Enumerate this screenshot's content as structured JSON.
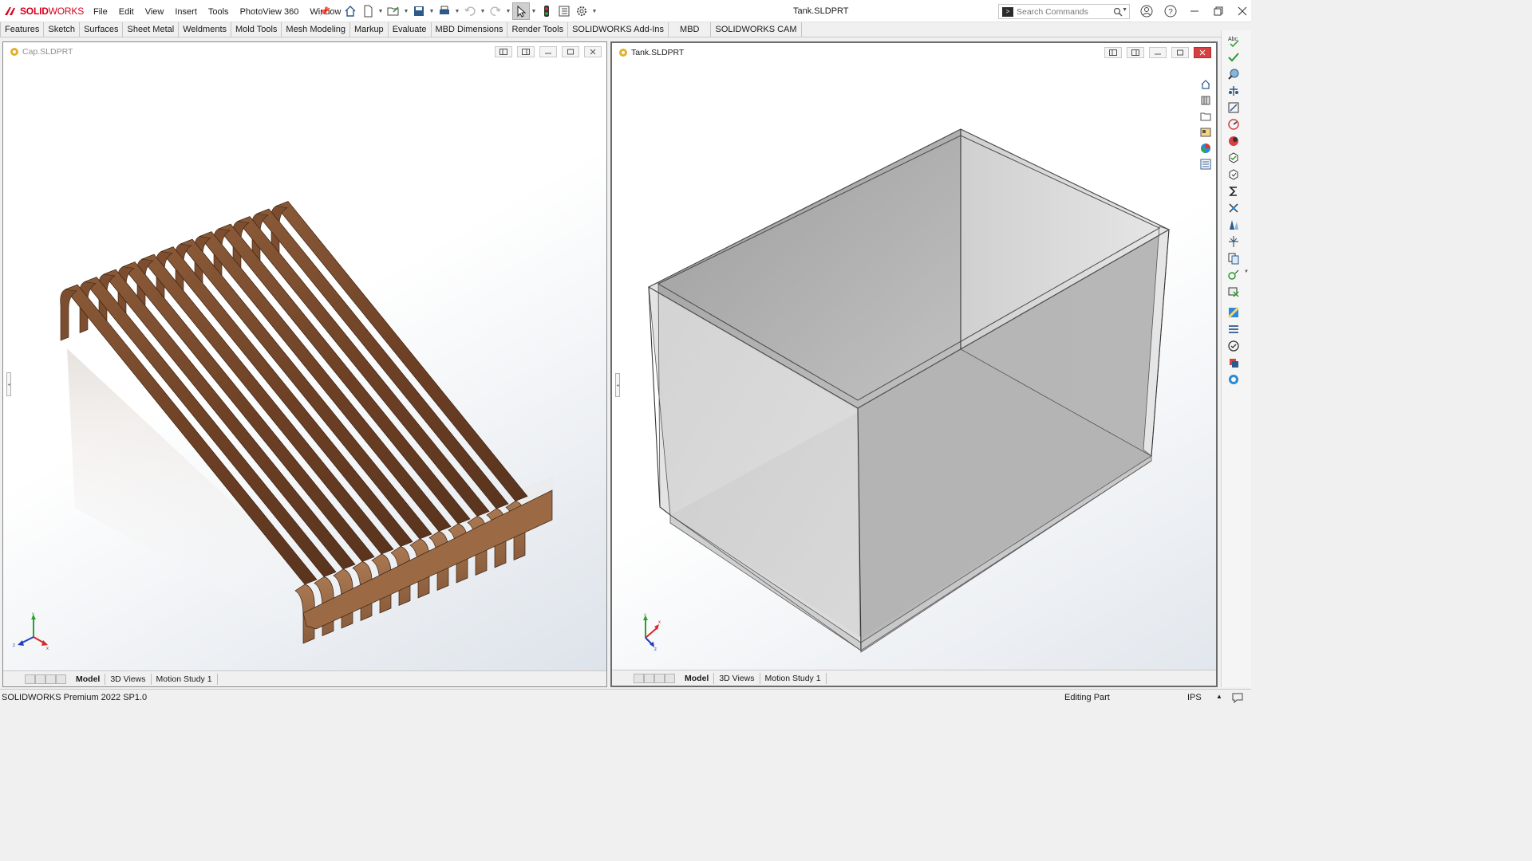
{
  "app": {
    "brand_prefix": "3S",
    "brand_bold": "SOLID",
    "brand_light": "WORKS",
    "document_title": "Tank.SLDPRT"
  },
  "menu": [
    "File",
    "Edit",
    "View",
    "Insert",
    "Tools",
    "PhotoView 360",
    "Window"
  ],
  "search": {
    "placeholder": "Search Commands"
  },
  "tabs": [
    "Features",
    "Sketch",
    "Surfaces",
    "Sheet Metal",
    "Weldments",
    "Mold Tools",
    "Mesh Modeling",
    "Markup",
    "Evaluate",
    "MBD Dimensions",
    "Render Tools",
    "SOLIDWORKS Add-Ins",
    "MBD",
    "SOLIDWORKS CAM"
  ],
  "left_view": {
    "title": "Cap.SLDPRT",
    "bottom_tabs": [
      "Model",
      "3D Views",
      "Motion Study 1"
    ],
    "active_tab": "Model"
  },
  "right_view": {
    "title": "Tank.SLDPRT",
    "bottom_tabs": [
      "Model",
      "3D Views",
      "Motion Study 1"
    ],
    "active_tab": "Model"
  },
  "triad": {
    "x": "x",
    "y": "y",
    "z": "z"
  },
  "status": {
    "product": "SOLIDWORKS Premium 2022 SP1.0",
    "mode": "Editing Part",
    "units": "IPS"
  },
  "colors": {
    "brand_red": "#d6001c",
    "wood_dark": "#6a3e22",
    "wood_light": "#9b6a45",
    "tank_gray": "#a9a9a9"
  }
}
